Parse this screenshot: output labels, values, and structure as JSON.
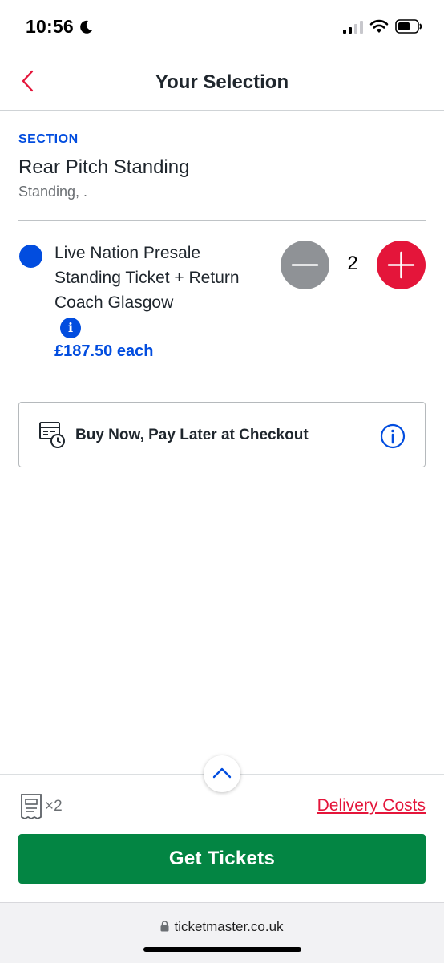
{
  "status_bar": {
    "time": "10:56"
  },
  "header": {
    "title": "Your Selection"
  },
  "section": {
    "label": "SECTION",
    "name": "Rear Pitch Standing",
    "sub": "Standing, ."
  },
  "ticket": {
    "name": "Live Nation Presale Standing Ticket + Return Coach Glasgow",
    "info_glyph": "i",
    "price": "£187.50 each",
    "quantity": "2"
  },
  "bnpl": {
    "text": "Buy Now, Pay Later at Checkout"
  },
  "footer": {
    "ticket_count": "×2",
    "delivery_link": "Delivery Costs",
    "cta": "Get Tickets"
  },
  "browser": {
    "url": "ticketmaster.co.uk"
  },
  "colors": {
    "accent_blue": "#024ddf",
    "accent_red": "#e4153a",
    "cta_green": "#038543",
    "minus_gray": "#8f9296"
  },
  "icons": {
    "back": "chevron-left-icon",
    "minus": "minus-icon",
    "plus": "plus-icon",
    "info": "info-icon",
    "bnpl": "calendar-clock-icon",
    "expand": "chevron-up-icon",
    "ticket": "ticket-icon",
    "lock": "lock-icon"
  }
}
